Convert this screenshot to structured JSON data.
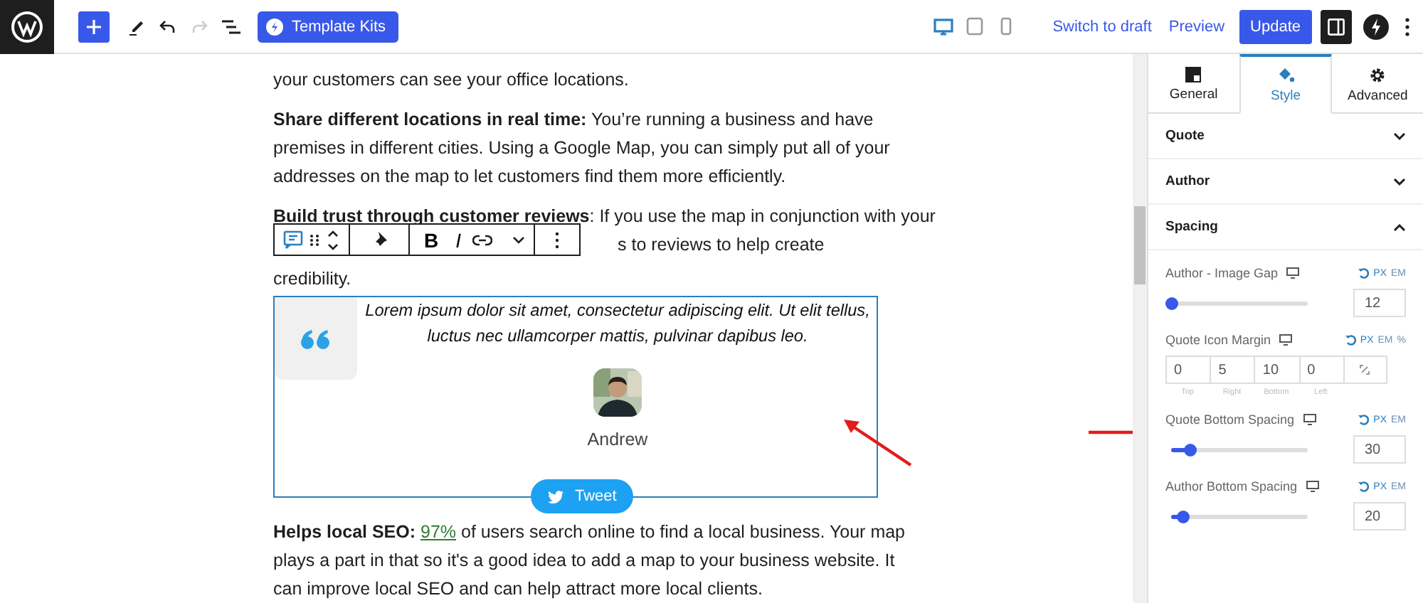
{
  "topbar": {
    "template_kits": "Template Kits",
    "devices": [
      {
        "kind": "desktop",
        "selected": true
      },
      {
        "kind": "tablet",
        "selected": false
      },
      {
        "kind": "mobile",
        "selected": false
      }
    ],
    "links": [
      "Switch to draft",
      "Preview"
    ],
    "update": "Update"
  },
  "content": {
    "intro_lines": [
      "your customers can see your office locations."
    ],
    "paragraph_lines": [
      "**Share different locations in real time:** You’re running a business and have",
      "premises in different cities. Using a Google Map, you can simply put all of your",
      "addresses on the map to let customers find them more efficiently."
    ],
    "covered_lines": [
      "**Build trust through customer reviews**: If you use the map in conjunction with your",
      "s to reviews to help create",
      "credibility."
    ],
    "block_toolbar": {
      "format": [
        "B",
        "I"
      ]
    },
    "testimonial": {
      "quote": "Lorem ipsum dolor sit amet, consectetur adipiscing elit. Ut elit tellus, luctus nec ullamcorper mattis, pulvinar dapibus leo.",
      "author": "Andrew",
      "tweet": "Tweet"
    },
    "last_paragraph": {
      "lead": "**Helps local SEO:** ",
      "link": "97%",
      "rest": " of users search online to find a local business. Your map",
      "more_lines": [
        "plays a part in that so it's a good idea to add a map to your business website. It",
        "can improve local SEO and can help attract more local clients."
      ]
    }
  },
  "sidebar": {
    "tabs": [
      {
        "kind": "general",
        "label": "General",
        "selected": false
      },
      {
        "kind": "style",
        "label": "Style",
        "selected": true
      },
      {
        "kind": "advanced",
        "label": "Advanced",
        "selected": false
      }
    ],
    "sections": [
      {
        "title": "Quote",
        "expanded": false
      },
      {
        "title": "Author",
        "expanded": false
      },
      {
        "title": "Spacing",
        "expanded": true
      }
    ],
    "controls": [
      {
        "kind": "slider",
        "label": "Author - Image Gap",
        "units": [
          {
            "label": "PX",
            "selected": true
          },
          {
            "label": "EM",
            "selected": false
          }
        ],
        "level": 0,
        "value": "12"
      },
      {
        "kind": "dimensions",
        "label": "Quote Icon Margin",
        "units": [
          {
            "label": "PX",
            "selected": true
          },
          {
            "label": "EM",
            "selected": false
          },
          {
            "label": "%",
            "selected": false
          }
        ],
        "fields": [
          {
            "value": "0",
            "label": "Top"
          },
          {
            "value": "5",
            "label": "Right"
          },
          {
            "value": "10",
            "label": "Bottom"
          },
          {
            "value": "0",
            "label": "Left"
          }
        ]
      },
      {
        "kind": "slider",
        "label": "Quote Bottom Spacing",
        "units": [
          {
            "label": "PX",
            "selected": true
          },
          {
            "label": "EM",
            "selected": false
          }
        ],
        "level": 0.14,
        "value": "30"
      },
      {
        "kind": "slider",
        "label": "Author Bottom Spacing",
        "units": [
          {
            "label": "PX",
            "selected": true
          },
          {
            "label": "EM",
            "selected": false
          }
        ],
        "level": 0.08,
        "value": "20"
      }
    ]
  }
}
